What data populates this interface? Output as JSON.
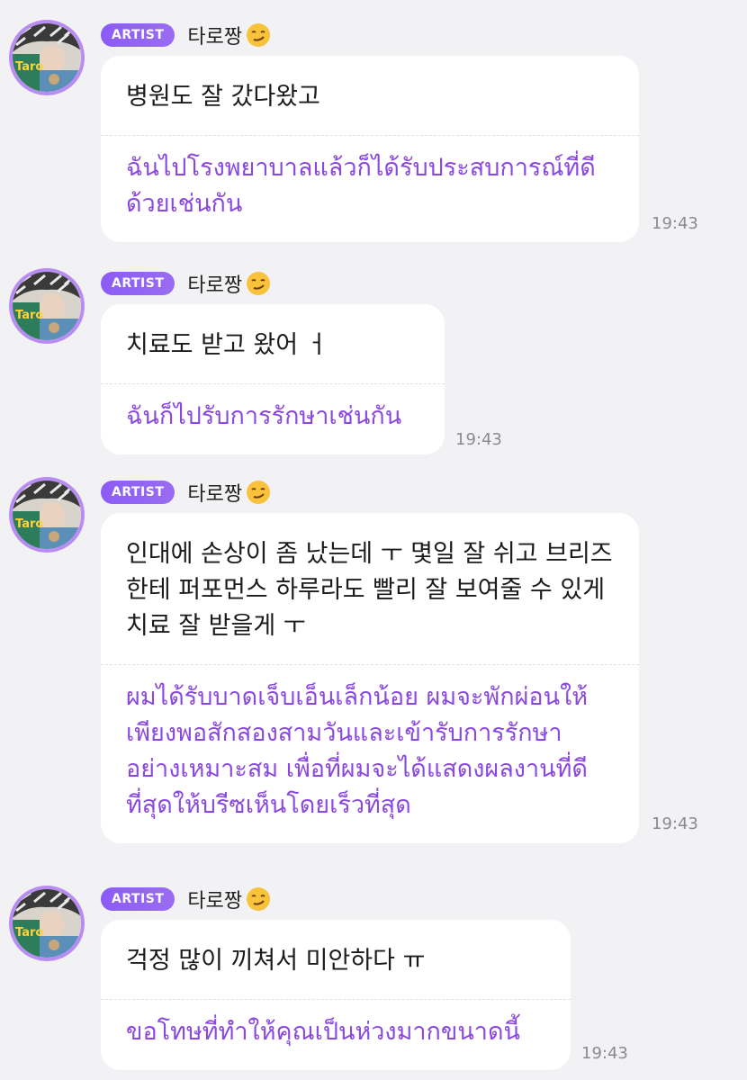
{
  "messages": [
    {
      "badge": "ARTIST",
      "sender": "타로짱",
      "sender_emoji": "smirk-emoji",
      "korean": "병원도 잘 갔다왔고",
      "thai": "ฉันไปโรงพยาบาลแล้วก็ได้รับประสบการณ์ที่ดีด้วยเช่นกัน",
      "time": "19:43"
    },
    {
      "badge": "ARTIST",
      "sender": "타로짱",
      "sender_emoji": "smirk-emoji",
      "korean": "치료도 받고 왔어 ㅓ",
      "thai": "ฉันก็ไปรับการรักษาเช่นกัน",
      "time": "19:43"
    },
    {
      "badge": "ARTIST",
      "sender": "타로짱",
      "sender_emoji": "smirk-emoji",
      "korean": "인대에 손상이 좀 났는데 ㅜ 몇일 잘 쉬고 브리즈한테 퍼포먼스 하루라도 빨리 잘 보여줄 수 있게 치료 잘 받을게 ㅜ",
      "thai": "ผมได้รับบาดเจ็บเอ็นเล็กน้อย ผมจะพักผ่อนให้เพียงพอสักสองสามวันและเข้ารับการรักษาอย่างเหมาะสม เพื่อที่ผมจะได้แสดงผลงานที่ดีที่สุดให้บรีซเห็นโดยเร็วที่สุด",
      "time": "19:43"
    },
    {
      "badge": "ARTIST",
      "sender": "타로짱",
      "sender_emoji": "smirk-emoji",
      "korean": "걱정 많이 끼쳐서 미안하다 ㅠ",
      "thai": "ขอโทษที่ทำให้คุณเป็นห่วงมากขนาดนี้",
      "time": "19:43"
    }
  ],
  "colors": {
    "background": "#f2f2f4",
    "badge": "#8a5cf6",
    "avatar_ring": "#b98cf4",
    "translation_text": "#8a48e0",
    "timestamp": "#8a8a90"
  }
}
